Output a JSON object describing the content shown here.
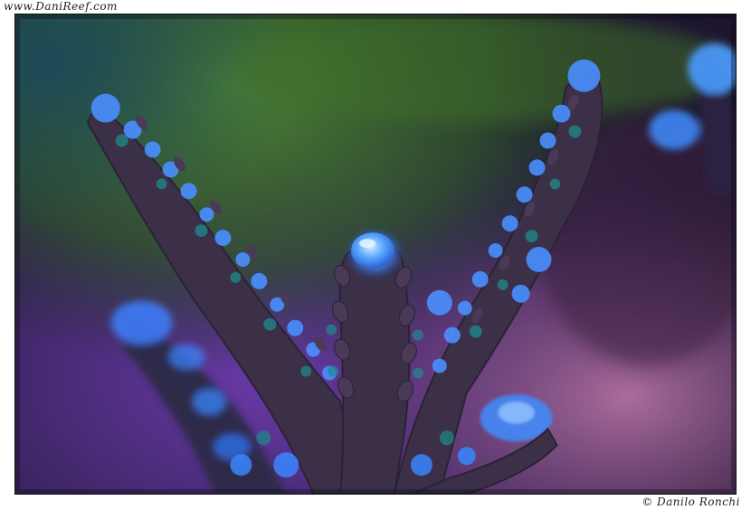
{
  "watermarks": {
    "site": "www.DaniReef.com",
    "copyright": "© Danilo Ronchi"
  },
  "photo": {
    "subject": "coral-branch",
    "colors": {
      "background_green": "#3d6a2a",
      "background_purple": "#5a3a8a",
      "background_pink": "#b06a9a",
      "coral_tissue": "#3a2e44",
      "polyp_glow": "#3f8cff",
      "polyp_highlight": "#8fc4ff"
    }
  }
}
